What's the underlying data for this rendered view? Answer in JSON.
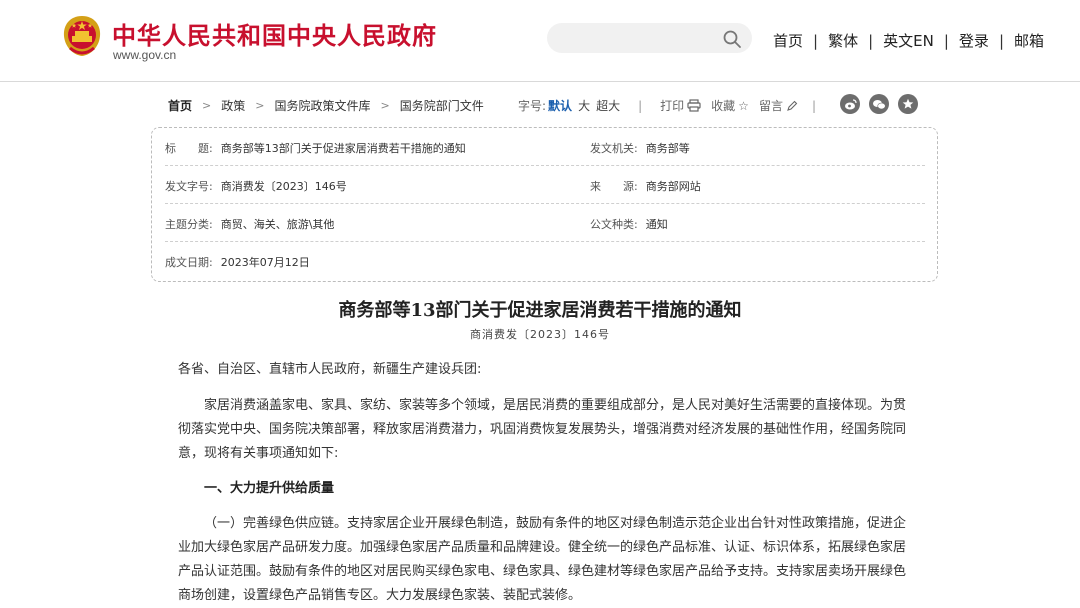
{
  "header": {
    "site_name": "中华人民共和国中央人民政府",
    "site_url": "www.gov.cn",
    "search_placeholder": "",
    "nav": [
      "首页",
      "繁体",
      "英文EN",
      "登录",
      "邮箱"
    ],
    "nav_separator": "|"
  },
  "breadcrumb": {
    "items": [
      "首页",
      "政策",
      "国务院政策文件库",
      "国务院部门文件"
    ]
  },
  "tools": {
    "font_label": "字号:",
    "font_default": "默认",
    "font_large": "大",
    "font_xlarge": "超大",
    "separator": "|",
    "print": "打印",
    "favorite": "收藏",
    "comment": "留言"
  },
  "share_icons": [
    "weibo-icon",
    "wechat-icon",
    "star-icon"
  ],
  "info": {
    "title_label": "标　　题:",
    "title_value": "商务部等13部门关于促进家居消费若干措施的通知",
    "issuer_label": "发文机关:",
    "issuer_value": "商务部等",
    "docno_label": "发文字号:",
    "docno_value": "商消费发〔2023〕146号",
    "source_label": "来　　源:",
    "source_value": "商务部网站",
    "topic_label": "主题分类:",
    "topic_value": "商贸、海关、旅游\\其他",
    "type_label": "公文种类:",
    "type_value": "通知",
    "date_label": "成文日期:",
    "date_value": "2023年07月12日"
  },
  "article": {
    "title": "商务部等13部门关于促进家居消费若干措施的通知",
    "doc_number": "商消费发〔2023〕146号",
    "salutation": "各省、自治区、直辖市人民政府，新疆生产建设兵团:",
    "intro": "家居消费涵盖家电、家具、家纺、家装等多个领域，是居民消费的重要组成部分，是人民对美好生活需要的直接体现。为贯彻落实党中央、国务院决策部署，释放家居消费潜力，巩固消费恢复发展势头，增强消费对经济发展的基础性作用，经国务院同意，现将有关事项通知如下:",
    "section1": "一、大力提升供给质量",
    "para1": "（一）完善绿色供应链。支持家居企业开展绿色制造，鼓励有条件的地区对绿色制造示范企业出台针对性政策措施，促进企业加大绿色家居产品研发力度。加强绿色家居产品质量和品牌建设。健全统一的绿色产品标准、认证、标识体系，拓展绿色家居产品认证范围。鼓励有条件的地区对居民购买绿色家电、绿色家具、绿色建材等绿色家居产品给予支持。支持家居卖场开展绿色商场创建，设置绿色产品销售专区。大力发展绿色家装、装配式装修。"
  },
  "colors": {
    "brand_red": "#c8102e",
    "link_blue": "#1b5fae"
  }
}
